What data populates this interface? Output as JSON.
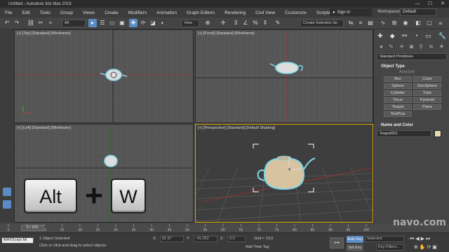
{
  "window": {
    "title": "Untitled - Autodesk 3ds Max 2018",
    "controls": [
      "—",
      "☐",
      "✕"
    ]
  },
  "menu": [
    "File",
    "Edit",
    "Tools",
    "Group",
    "Views",
    "Create",
    "Modifiers",
    "Animation",
    "Graph Editors",
    "Rendering",
    "Civil View",
    "Customize",
    "Scripting"
  ],
  "account": {
    "signin_label": "Sign In",
    "workspaces_label": "Workspaces:",
    "workspace_value": "Default"
  },
  "toolbar": {
    "filter_value": "All",
    "ref_coord_value": "View",
    "selection_set_value": "Create Selection Se"
  },
  "viewports": {
    "top": "[+] [Top] [Standard] [Wireframe]",
    "front": "[+] [Front] [Standard] [Wireframe]",
    "left": "[+] [Left] [Standard] [Wireframe]",
    "perspective": "[+] [Perspective] [Standard] [Default Shading]"
  },
  "keys": {
    "alt": "Alt",
    "plus": "+",
    "w": "W"
  },
  "command_panel": {
    "category_value": "Standard Primitives",
    "object_type_header": "Object Type",
    "autogrid_label": "AutoGrid",
    "object_buttons": [
      "Box",
      "Cone",
      "Sphere",
      "GeoSphere",
      "Cylinder",
      "Tube",
      "Torus",
      "Pyramid",
      "Teapot",
      "Plane",
      "TextPlus"
    ],
    "name_color_header": "Name and Color",
    "object_name": "Teapot001"
  },
  "timeline": {
    "frame_label": "0 / 100",
    "ticks": [
      "0",
      "5",
      "10",
      "15",
      "20",
      "25",
      "30",
      "35",
      "40",
      "45",
      "50",
      "55",
      "60",
      "65",
      "70",
      "75",
      "80",
      "85",
      "90",
      "95",
      "100"
    ]
  },
  "status": {
    "selection": "1 Object Selected",
    "prompt": "Click or click-and-drag to select objects",
    "maxscript": "MAXScript Mi",
    "x_label": "X:",
    "x_value": "81.97",
    "y_label": "Y:",
    "y_value": "-41.252",
    "z_label": "Z:",
    "z_value": "0.0",
    "grid_label": "Grid = 10,0",
    "add_time_tag": "Add Time Tag",
    "autokey_label": "Auto Key",
    "setkey_label": "Set Key",
    "selected_value": "Selected",
    "key_filters": "Key Filters..."
  },
  "watermark": "navo.com",
  "colors": {
    "accent": "#5b8bc4",
    "active_viewport_border": "#d9a300",
    "selection_highlight": "#7fd8e6"
  }
}
